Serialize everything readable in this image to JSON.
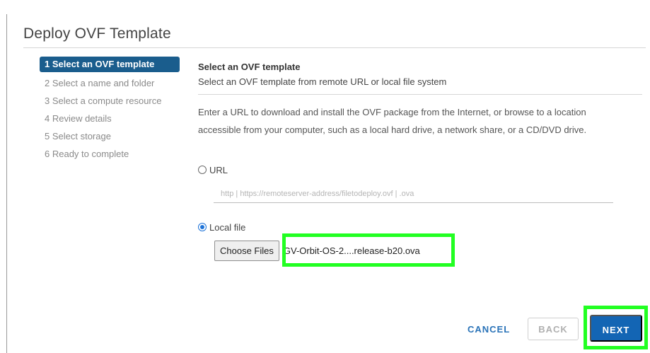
{
  "wizard": {
    "title": "Deploy OVF Template",
    "steps": [
      {
        "label": "1 Select an OVF template",
        "active": true
      },
      {
        "label": "2 Select a name and folder",
        "active": false
      },
      {
        "label": "3 Select a compute resource",
        "active": false
      },
      {
        "label": "4 Review details",
        "active": false
      },
      {
        "label": "5 Select storage",
        "active": false
      },
      {
        "label": "6 Ready to complete",
        "active": false
      }
    ]
  },
  "content": {
    "heading": "Select an OVF template",
    "subheading": "Select an OVF template from remote URL or local file system",
    "description": "Enter a URL to download and install the OVF package from the Internet, or browse to a location accessible from your computer, such as a local hard drive, a network share, or a CD/DVD drive.",
    "url_option_label": "URL",
    "url_option_checked": false,
    "url_placeholder": "http | https://remoteserver-address/filetodeploy.ovf | .ova",
    "local_option_label": "Local file",
    "local_option_checked": true,
    "choose_files_label": "Choose Files",
    "selected_file": "GV-Orbit-OS-2....release-b20.ova"
  },
  "footer": {
    "cancel_label": "CANCEL",
    "back_label": "BACK",
    "next_label": "NEXT"
  },
  "colors": {
    "active_step_bg": "#1a5d8d",
    "primary_button": "#1365b4",
    "highlight": "#22ff22"
  }
}
